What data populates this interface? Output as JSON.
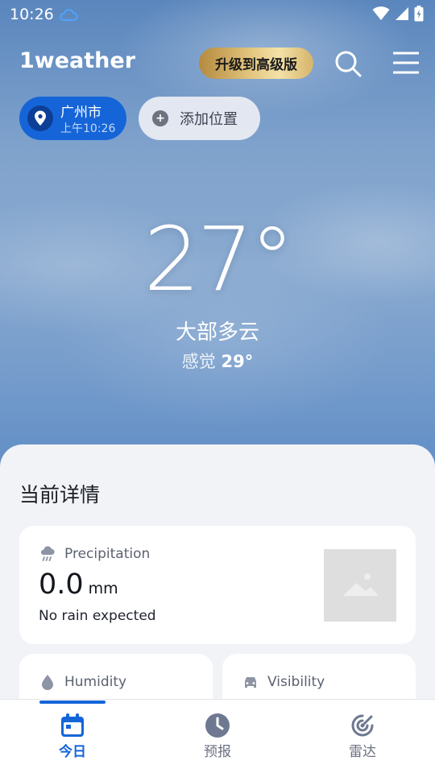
{
  "status_bar": {
    "time": "10:26"
  },
  "header": {
    "logo": "1weather",
    "premium_label": "升级到高级版"
  },
  "locations": {
    "current": {
      "city": "广州市",
      "time": "上午10:26"
    },
    "add_label": "添加位置"
  },
  "weather": {
    "temperature": "27°",
    "condition": "大部多云",
    "feels_like_label": "感觉",
    "feels_like_value": "29°"
  },
  "details": {
    "title": "当前详情",
    "precipitation": {
      "label": "Precipitation",
      "value": "0.0",
      "unit": "mm",
      "description": "No rain expected"
    },
    "humidity": {
      "label": "Humidity"
    },
    "visibility": {
      "label": "Visibility"
    }
  },
  "bottom_nav": {
    "items": [
      {
        "label": "今日",
        "icon": "calendar-icon",
        "active": true
      },
      {
        "label": "预报",
        "icon": "clock-icon",
        "active": false
      },
      {
        "label": "雷达",
        "icon": "radar-icon",
        "active": false
      }
    ]
  },
  "colors": {
    "accent": "#1565d8",
    "premium_gold": "#e3c57e",
    "panel_bg": "#f1f3f7"
  }
}
